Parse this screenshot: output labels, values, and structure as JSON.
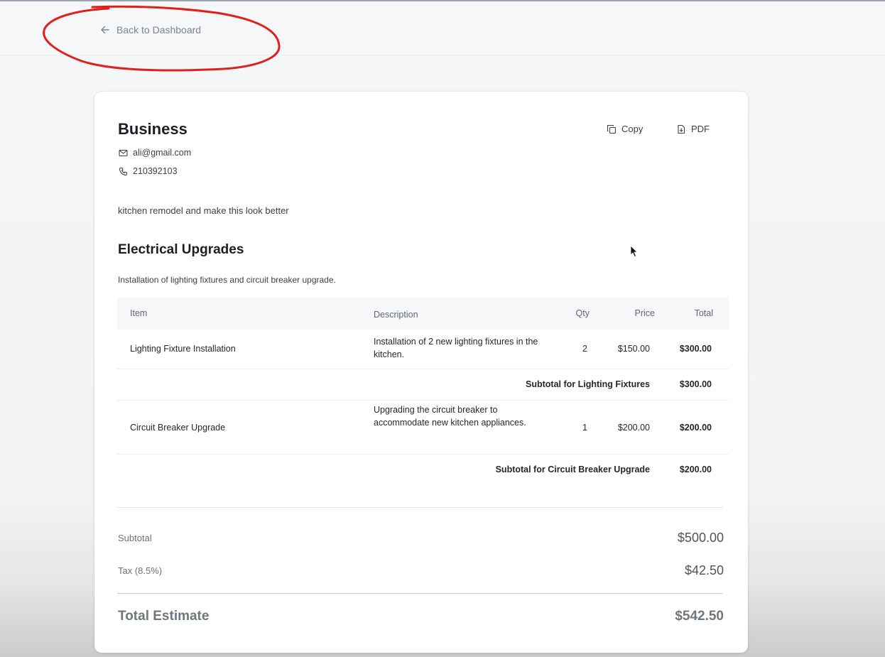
{
  "nav": {
    "back_label": "Back to Dashboard"
  },
  "business": {
    "name": "Business",
    "email": "ali@gmail.com",
    "phone": "210392103"
  },
  "actions": {
    "copy_label": "Copy",
    "pdf_label": "PDF"
  },
  "project": {
    "description": "kitchen remodel and make this look better"
  },
  "section": {
    "title": "Electrical Upgrades",
    "description": "Installation of lighting fixtures and circuit breaker upgrade.",
    "columns": {
      "item": "Item",
      "description": "Description",
      "qty": "Qty",
      "price": "Price",
      "total": "Total"
    },
    "rows": [
      {
        "item": "Lighting Fixture Installation",
        "description": "Installation of 2 new lighting fixtures in the kitchen.",
        "qty": "2",
        "price": "$150.00",
        "total": "$300.00",
        "subtotal_label": "Subtotal for Lighting Fixtures",
        "subtotal_value": "$300.00"
      },
      {
        "item": "Circuit Breaker Upgrade",
        "description": "Upgrading the circuit breaker to accommodate new kitchen appliances.",
        "qty": "1",
        "price": "$200.00",
        "total": "$200.00",
        "subtotal_label": "Subtotal for Circuit Breaker Upgrade",
        "subtotal_value": "$200.00"
      }
    ]
  },
  "summary": {
    "subtotal_label": "Subtotal",
    "subtotal_value": "$500.00",
    "tax_label": "Tax (8.5%)",
    "tax_value": "$42.50",
    "total_label": "Total Estimate",
    "total_value": "$542.50"
  },
  "colors": {
    "annotation": "#e0201c",
    "card_bg": "#ffffff",
    "page_bg": "#f4f6f8"
  },
  "icons": [
    "arrow-left-icon",
    "mail-icon",
    "phone-icon",
    "copy-icon",
    "file-pdf-icon",
    "mouse-cursor-icon"
  ]
}
